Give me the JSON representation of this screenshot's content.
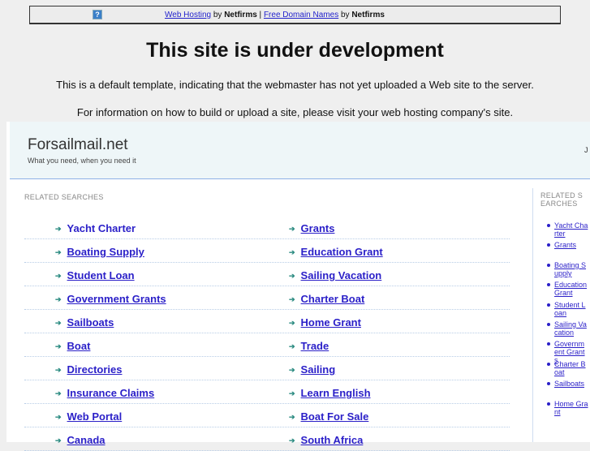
{
  "topbar": {
    "help_icon": "?",
    "link1": "Web Hosting",
    "by1": " by ",
    "brand1": "Netfirms",
    "sep": " | ",
    "link2": "Free Domain Names",
    "by2": " by ",
    "brand2": "Netfirms"
  },
  "title": "This site is under development",
  "para1": "This is a default template, indicating that the webmaster has not yet uploaded a Web site to the server.",
  "para2": "For information on how to build or upload a site, please visit your web hosting company's site.",
  "header": {
    "site_name": "Forsailmail.net",
    "tagline": "What you need, when you need it",
    "right_text": "J"
  },
  "main": {
    "label": "RELATED SEARCHES",
    "rows": [
      [
        "Yacht Charter",
        "Grants"
      ],
      [
        "Boating Supply",
        "Education Grant"
      ],
      [
        "Student Loan",
        "Sailing Vacation"
      ],
      [
        "Government Grants",
        "Charter Boat"
      ],
      [
        "Sailboats",
        "Home Grant"
      ],
      [
        "Boat",
        "Trade"
      ],
      [
        "Directories",
        "Sailing"
      ],
      [
        "Insurance Claims",
        "Learn English"
      ],
      [
        "Web Portal",
        "Boat For Sale"
      ],
      [
        "Canada",
        "South Africa"
      ]
    ]
  },
  "sidebar": {
    "label": "RELATED SEARCHES",
    "items": [
      "Yacht Charter",
      "Grants",
      "Boating Supply",
      "Education Grant",
      "Student Loan",
      "Sailing Vacation",
      "Government Grants",
      "Charter Boat",
      "Sailboats",
      "Home Grant"
    ]
  }
}
